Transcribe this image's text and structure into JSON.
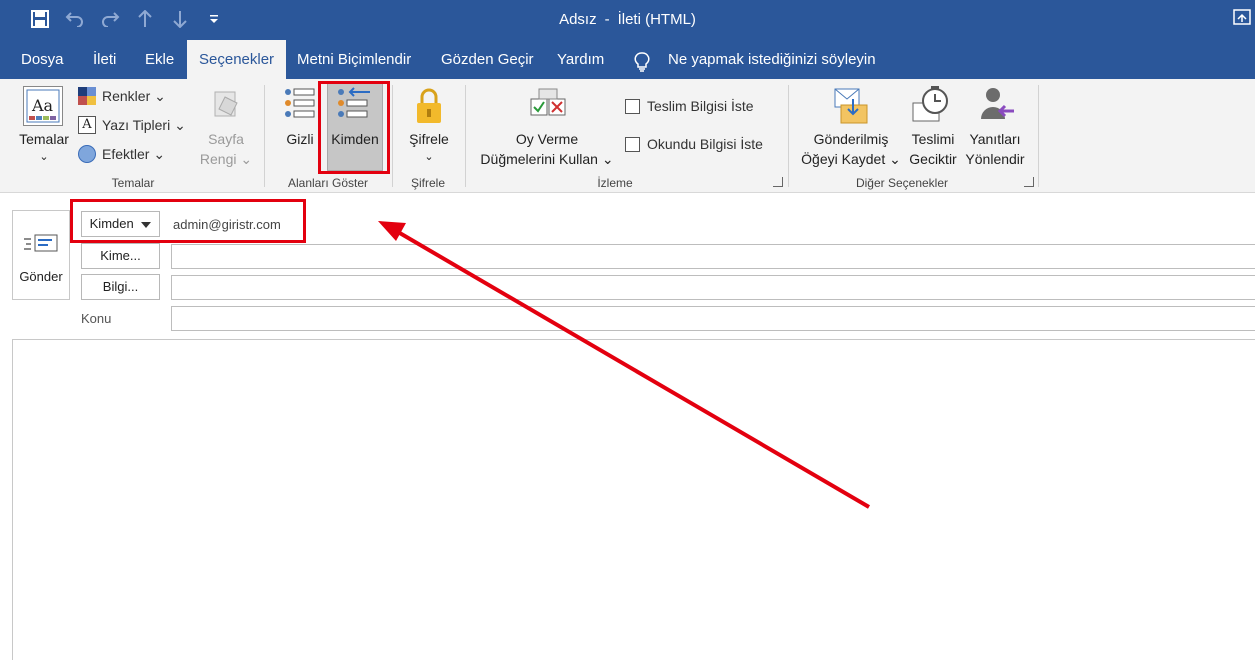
{
  "window": {
    "title_doc": "Adsız",
    "title_sep": "-",
    "title_type": "İleti (HTML)"
  },
  "quick_access": {
    "icons": [
      "save-icon",
      "undo-icon",
      "redo-icon",
      "up-arrow-icon",
      "down-arrow-icon",
      "customize-icon"
    ]
  },
  "tabs": [
    "Dosya",
    "İleti",
    "Ekle",
    "Seçenekler",
    "Metni Biçimlendir",
    "Gözden Geçir",
    "Yardım"
  ],
  "active_tab": "Seçenekler",
  "tell_me": "Ne yapmak istediğinizi söyleyin",
  "ribbon": {
    "themes": {
      "temalar": "Temalar",
      "renkler": "Renkler",
      "yazi_tipleri": "Yazı Tipleri",
      "efektler": "Efektler",
      "sayfa": "Sayfa",
      "rengi": "Rengi",
      "group": "Temalar"
    },
    "show_fields": {
      "gizli": "Gizli",
      "kimden": "Kimden",
      "group": "Alanları Göster"
    },
    "encrypt": {
      "sifrele": "Şifrele",
      "group": "Şifrele"
    },
    "tracking": {
      "oy_line1": "Oy Verme",
      "oy_line2": "Düğmelerini Kullan",
      "teslim": "Teslim Bilgisi İste",
      "okundu": "Okundu Bilgisi İste",
      "group": "İzleme"
    },
    "more": {
      "gonderilmis1": "Gönderilmiş",
      "gonderilmis2": "Öğeyi Kaydet",
      "teslimi1": "Teslimi",
      "teslimi2": "Geciktir",
      "yanitlari1": "Yanıtları",
      "yanitlari2": "Yönlendir",
      "group": "Diğer Seçenekler"
    }
  },
  "compose": {
    "send": "Gönder",
    "from_button": "Kimden",
    "from_value": "admin@giristr.com",
    "to_button": "Kime...",
    "cc_button": "Bilgi...",
    "subject_label": "Konu"
  },
  "colors": {
    "title_bar": "#2b579a",
    "ribbon_bg": "#f3f3f3",
    "highlight": "#e3000f"
  }
}
